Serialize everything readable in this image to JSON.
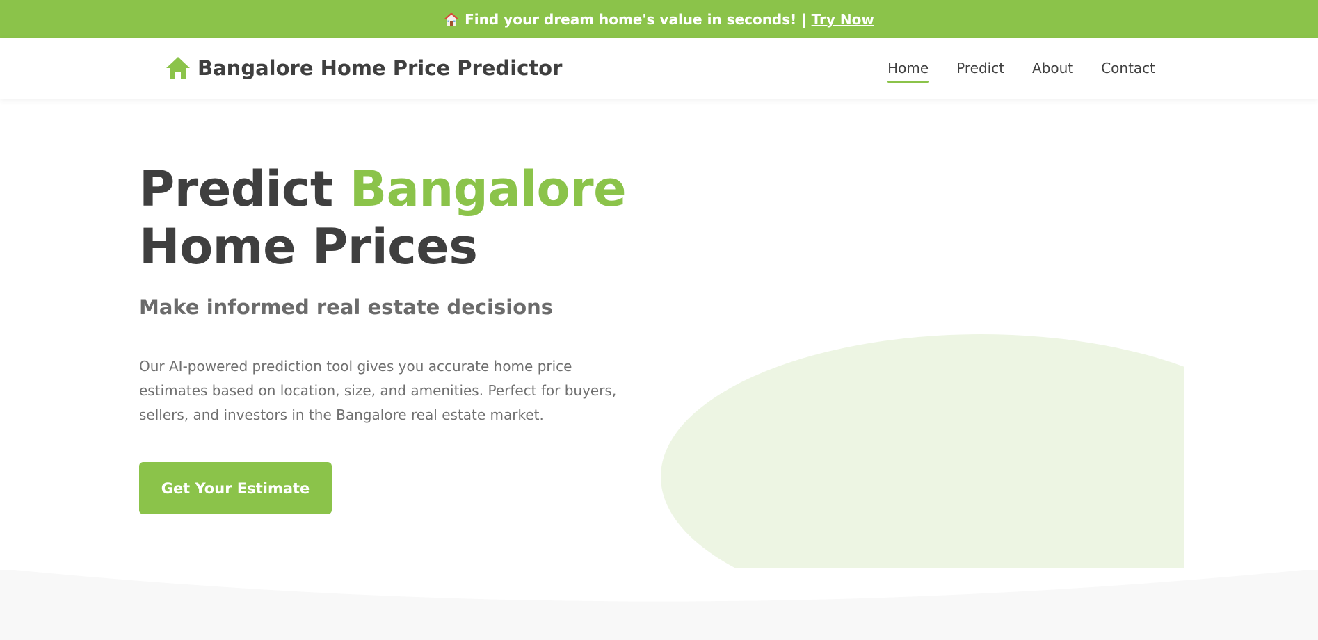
{
  "banner": {
    "icon": "house-emoji-icon",
    "text": "Find your dream home's value in seconds!",
    "separator": "|",
    "link_label": "Try Now"
  },
  "header": {
    "brand_icon": "house-icon",
    "brand_title": "Bangalore Home Price Predictor",
    "nav": [
      {
        "label": "Home",
        "active": true
      },
      {
        "label": "Predict",
        "active": false
      },
      {
        "label": "About",
        "active": false
      },
      {
        "label": "Contact",
        "active": false
      }
    ]
  },
  "hero": {
    "headline_part1": "Predict",
    "headline_accent": "Bangalore",
    "headline_part2": "Home Prices",
    "subheadline": "Make informed real estate decisions",
    "description": "Our AI-powered prediction tool gives you accurate home price estimates based on location, size, and amenities. Perfect for buyers, sellers, and investors in the Bangalore real estate market.",
    "cta_label": "Get Your Estimate"
  },
  "colors": {
    "accent": "#8bc34a",
    "text_dark": "#3f3f3f",
    "text_muted": "#707070",
    "blob": "#edf5e3",
    "section_bg": "#f8f8f8"
  }
}
